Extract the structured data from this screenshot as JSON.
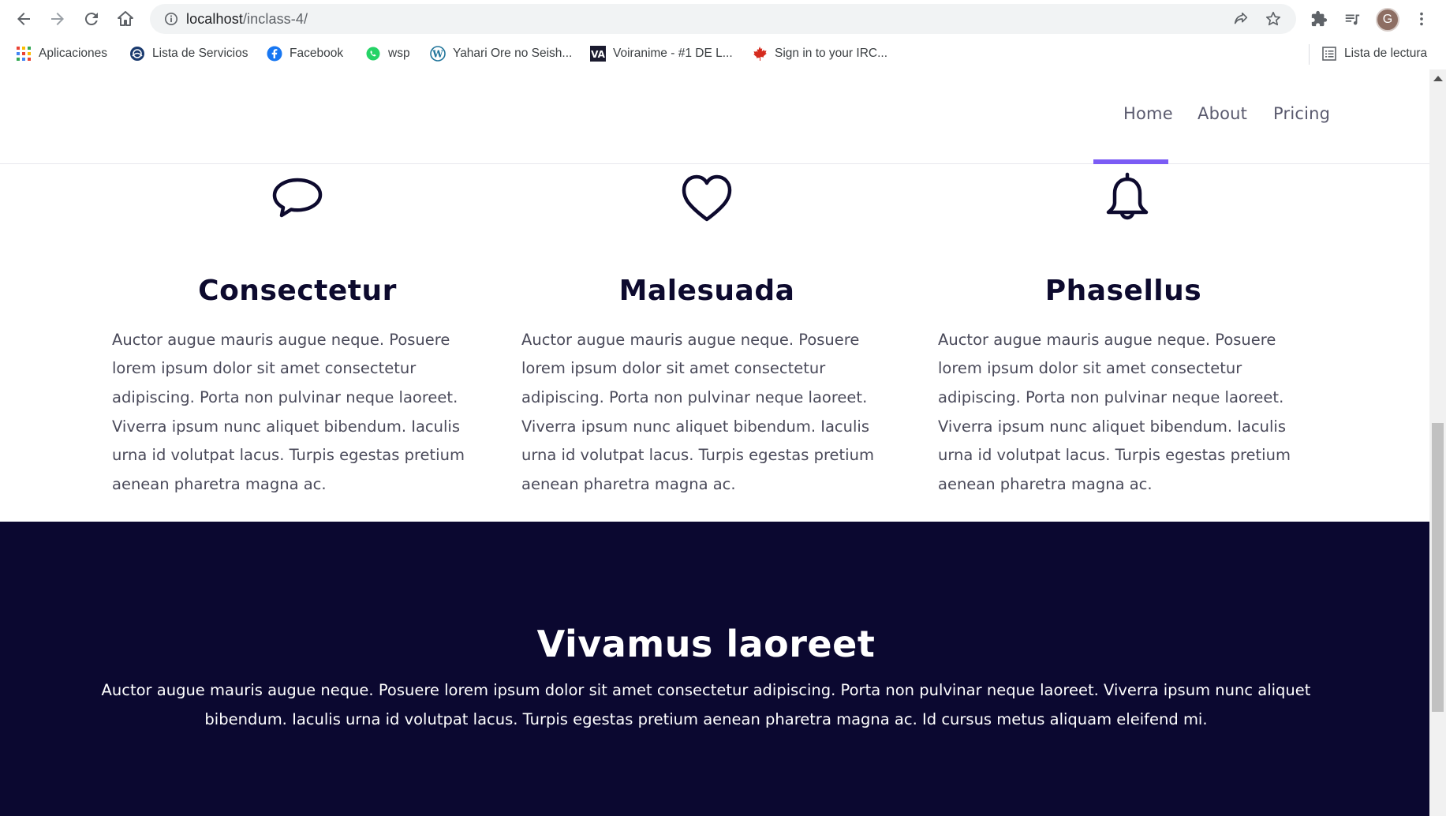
{
  "browser": {
    "url_host": "localhost",
    "url_path": "/inclass-4/",
    "profile_initial": "G",
    "bookmarks": [
      {
        "label": "Aplicaciones",
        "icon": "apps-grid-icon"
      },
      {
        "label": "Lista de Servicios",
        "icon": "globe-icon"
      },
      {
        "label": "Facebook",
        "icon": "facebook-icon"
      },
      {
        "label": "wsp",
        "icon": "whatsapp-icon"
      },
      {
        "label": "Yahari Ore no Seish...",
        "icon": "wordpress-icon"
      },
      {
        "label": "Voiranime - #1 DE L...",
        "icon": "voiranime-icon"
      },
      {
        "label": "Sign in to your IRC...",
        "icon": "maple-leaf-icon"
      }
    ],
    "reading_list_label": "Lista de lectura"
  },
  "site": {
    "nav": [
      {
        "label": "Home",
        "active": true
      },
      {
        "label": "About",
        "active": false
      },
      {
        "label": "Pricing",
        "active": false
      }
    ],
    "accent_color": "#7b5cf5",
    "dark_color": "#0b0830"
  },
  "features": [
    {
      "icon": "speech-bubble-icon",
      "title": "Consectetur",
      "text": "Auctor augue mauris augue neque. Posuere lorem ipsum dolor sit amet consectetur adipiscing. Porta non pulvinar neque laoreet. Viverra ipsum nunc aliquet bibendum. Iaculis urna id volutpat lacus. Turpis egestas pretium aenean pharetra magna ac."
    },
    {
      "icon": "heart-icon",
      "title": "Malesuada",
      "text": "Auctor augue mauris augue neque. Posuere lorem ipsum dolor sit amet consectetur adipiscing. Porta non pulvinar neque laoreet. Viverra ipsum nunc aliquet bibendum. Iaculis urna id volutpat lacus. Turpis egestas pretium aenean pharetra magna ac."
    },
    {
      "icon": "bell-icon",
      "title": "Phasellus",
      "text": "Auctor augue mauris augue neque. Posuere lorem ipsum dolor sit amet consectetur adipiscing. Porta non pulvinar neque laoreet. Viverra ipsum nunc aliquet bibendum. Iaculis urna id volutpat lacus. Turpis egestas pretium aenean pharetra magna ac."
    }
  ],
  "cta": {
    "title": "Vivamus laoreet",
    "text": "Auctor augue mauris augue neque. Posuere lorem ipsum dolor sit amet consectetur adipiscing. Porta non pulvinar neque laoreet. Viverra ipsum nunc aliquet bibendum. Iaculis urna id volutpat lacus. Turpis egestas pretium aenean pharetra magna ac. Id cursus metus aliquam eleifend mi."
  }
}
